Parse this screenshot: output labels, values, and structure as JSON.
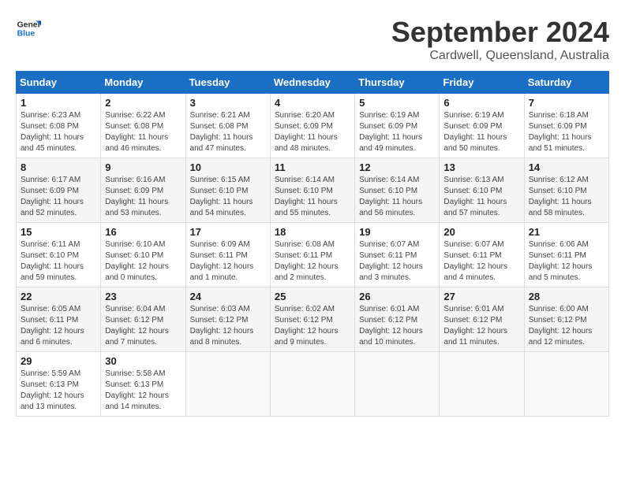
{
  "header": {
    "logo_general": "General",
    "logo_blue": "Blue",
    "month": "September 2024",
    "location": "Cardwell, Queensland, Australia"
  },
  "weekdays": [
    "Sunday",
    "Monday",
    "Tuesday",
    "Wednesday",
    "Thursday",
    "Friday",
    "Saturday"
  ],
  "weeks": [
    [
      {
        "day": "1",
        "sunrise": "6:23 AM",
        "sunset": "6:08 PM",
        "daylight": "11 hours and 45 minutes."
      },
      {
        "day": "2",
        "sunrise": "6:22 AM",
        "sunset": "6:08 PM",
        "daylight": "11 hours and 46 minutes."
      },
      {
        "day": "3",
        "sunrise": "6:21 AM",
        "sunset": "6:08 PM",
        "daylight": "11 hours and 47 minutes."
      },
      {
        "day": "4",
        "sunrise": "6:20 AM",
        "sunset": "6:09 PM",
        "daylight": "11 hours and 48 minutes."
      },
      {
        "day": "5",
        "sunrise": "6:19 AM",
        "sunset": "6:09 PM",
        "daylight": "11 hours and 49 minutes."
      },
      {
        "day": "6",
        "sunrise": "6:19 AM",
        "sunset": "6:09 PM",
        "daylight": "11 hours and 50 minutes."
      },
      {
        "day": "7",
        "sunrise": "6:18 AM",
        "sunset": "6:09 PM",
        "daylight": "11 hours and 51 minutes."
      }
    ],
    [
      {
        "day": "8",
        "sunrise": "6:17 AM",
        "sunset": "6:09 PM",
        "daylight": "11 hours and 52 minutes."
      },
      {
        "day": "9",
        "sunrise": "6:16 AM",
        "sunset": "6:09 PM",
        "daylight": "11 hours and 53 minutes."
      },
      {
        "day": "10",
        "sunrise": "6:15 AM",
        "sunset": "6:10 PM",
        "daylight": "11 hours and 54 minutes."
      },
      {
        "day": "11",
        "sunrise": "6:14 AM",
        "sunset": "6:10 PM",
        "daylight": "11 hours and 55 minutes."
      },
      {
        "day": "12",
        "sunrise": "6:14 AM",
        "sunset": "6:10 PM",
        "daylight": "11 hours and 56 minutes."
      },
      {
        "day": "13",
        "sunrise": "6:13 AM",
        "sunset": "6:10 PM",
        "daylight": "11 hours and 57 minutes."
      },
      {
        "day": "14",
        "sunrise": "6:12 AM",
        "sunset": "6:10 PM",
        "daylight": "11 hours and 58 minutes."
      }
    ],
    [
      {
        "day": "15",
        "sunrise": "6:11 AM",
        "sunset": "6:10 PM",
        "daylight": "11 hours and 59 minutes."
      },
      {
        "day": "16",
        "sunrise": "6:10 AM",
        "sunset": "6:10 PM",
        "daylight": "12 hours and 0 minutes."
      },
      {
        "day": "17",
        "sunrise": "6:09 AM",
        "sunset": "6:11 PM",
        "daylight": "12 hours and 1 minute."
      },
      {
        "day": "18",
        "sunrise": "6:08 AM",
        "sunset": "6:11 PM",
        "daylight": "12 hours and 2 minutes."
      },
      {
        "day": "19",
        "sunrise": "6:07 AM",
        "sunset": "6:11 PM",
        "daylight": "12 hours and 3 minutes."
      },
      {
        "day": "20",
        "sunrise": "6:07 AM",
        "sunset": "6:11 PM",
        "daylight": "12 hours and 4 minutes."
      },
      {
        "day": "21",
        "sunrise": "6:06 AM",
        "sunset": "6:11 PM",
        "daylight": "12 hours and 5 minutes."
      }
    ],
    [
      {
        "day": "22",
        "sunrise": "6:05 AM",
        "sunset": "6:11 PM",
        "daylight": "12 hours and 6 minutes."
      },
      {
        "day": "23",
        "sunrise": "6:04 AM",
        "sunset": "6:12 PM",
        "daylight": "12 hours and 7 minutes."
      },
      {
        "day": "24",
        "sunrise": "6:03 AM",
        "sunset": "6:12 PM",
        "daylight": "12 hours and 8 minutes."
      },
      {
        "day": "25",
        "sunrise": "6:02 AM",
        "sunset": "6:12 PM",
        "daylight": "12 hours and 9 minutes."
      },
      {
        "day": "26",
        "sunrise": "6:01 AM",
        "sunset": "6:12 PM",
        "daylight": "12 hours and 10 minutes."
      },
      {
        "day": "27",
        "sunrise": "6:01 AM",
        "sunset": "6:12 PM",
        "daylight": "12 hours and 11 minutes."
      },
      {
        "day": "28",
        "sunrise": "6:00 AM",
        "sunset": "6:12 PM",
        "daylight": "12 hours and 12 minutes."
      }
    ],
    [
      {
        "day": "29",
        "sunrise": "5:59 AM",
        "sunset": "6:13 PM",
        "daylight": "12 hours and 13 minutes."
      },
      {
        "day": "30",
        "sunrise": "5:58 AM",
        "sunset": "6:13 PM",
        "daylight": "12 hours and 14 minutes."
      },
      null,
      null,
      null,
      null,
      null
    ]
  ]
}
